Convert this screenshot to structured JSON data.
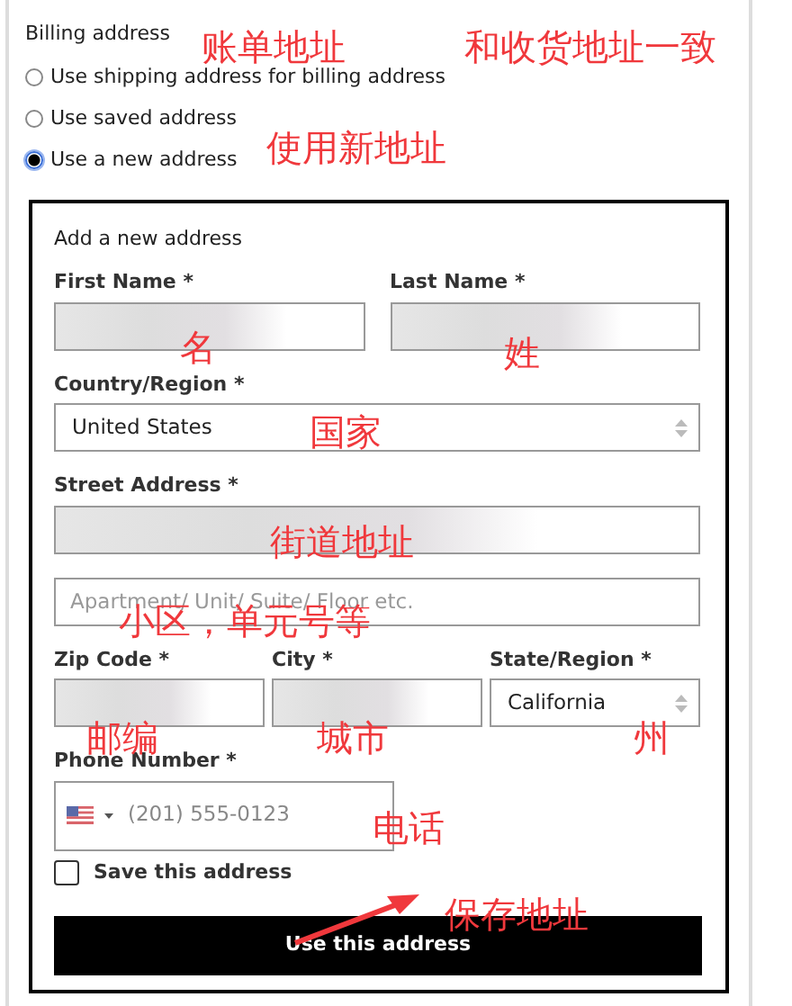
{
  "billing": {
    "title": "Billing address",
    "options": [
      {
        "label": "Use shipping address for billing address",
        "selected": false
      },
      {
        "label": "Use saved address",
        "selected": false
      },
      {
        "label": "Use a new address",
        "selected": true
      }
    ]
  },
  "new_address": {
    "title": "Add a new address",
    "rows": [
      [
        {
          "kind": "text",
          "label": "First Name *",
          "redacted": true
        },
        {
          "kind": "text",
          "label": "Last Name *",
          "redacted": true
        }
      ],
      [
        {
          "kind": "select",
          "label": "Country/Region *",
          "value": "United States"
        }
      ],
      [
        {
          "kind": "text",
          "label": "Street Address *",
          "redacted": true
        }
      ],
      [
        {
          "kind": "text",
          "placeholder": "Apartment/ Unit/ Suite/ Floor etc."
        }
      ],
      [
        {
          "kind": "text",
          "label": "Zip Code *",
          "redacted": true
        },
        {
          "kind": "text",
          "label": "City *",
          "redacted": true
        },
        {
          "kind": "select",
          "label": "State/Region *",
          "value": "California"
        }
      ],
      [
        {
          "kind": "phone",
          "label": "Phone Number *",
          "placeholder": "(201) 555-0123"
        }
      ]
    ],
    "save": {
      "label": "Save this address",
      "checked": false
    },
    "button": "Use this address"
  },
  "annotations": [
    {
      "text": "账单地址"
    },
    {
      "text": "和收货地址一致"
    },
    {
      "text": "使用新地址"
    },
    {
      "text": "名"
    },
    {
      "text": "姓"
    },
    {
      "text": "国家"
    },
    {
      "text": "街道地址"
    },
    {
      "text": "小区，单元号等"
    },
    {
      "text": "邮编"
    },
    {
      "text": "城市"
    },
    {
      "text": "州"
    },
    {
      "text": "电话"
    },
    {
      "text": "保存地址"
    }
  ]
}
